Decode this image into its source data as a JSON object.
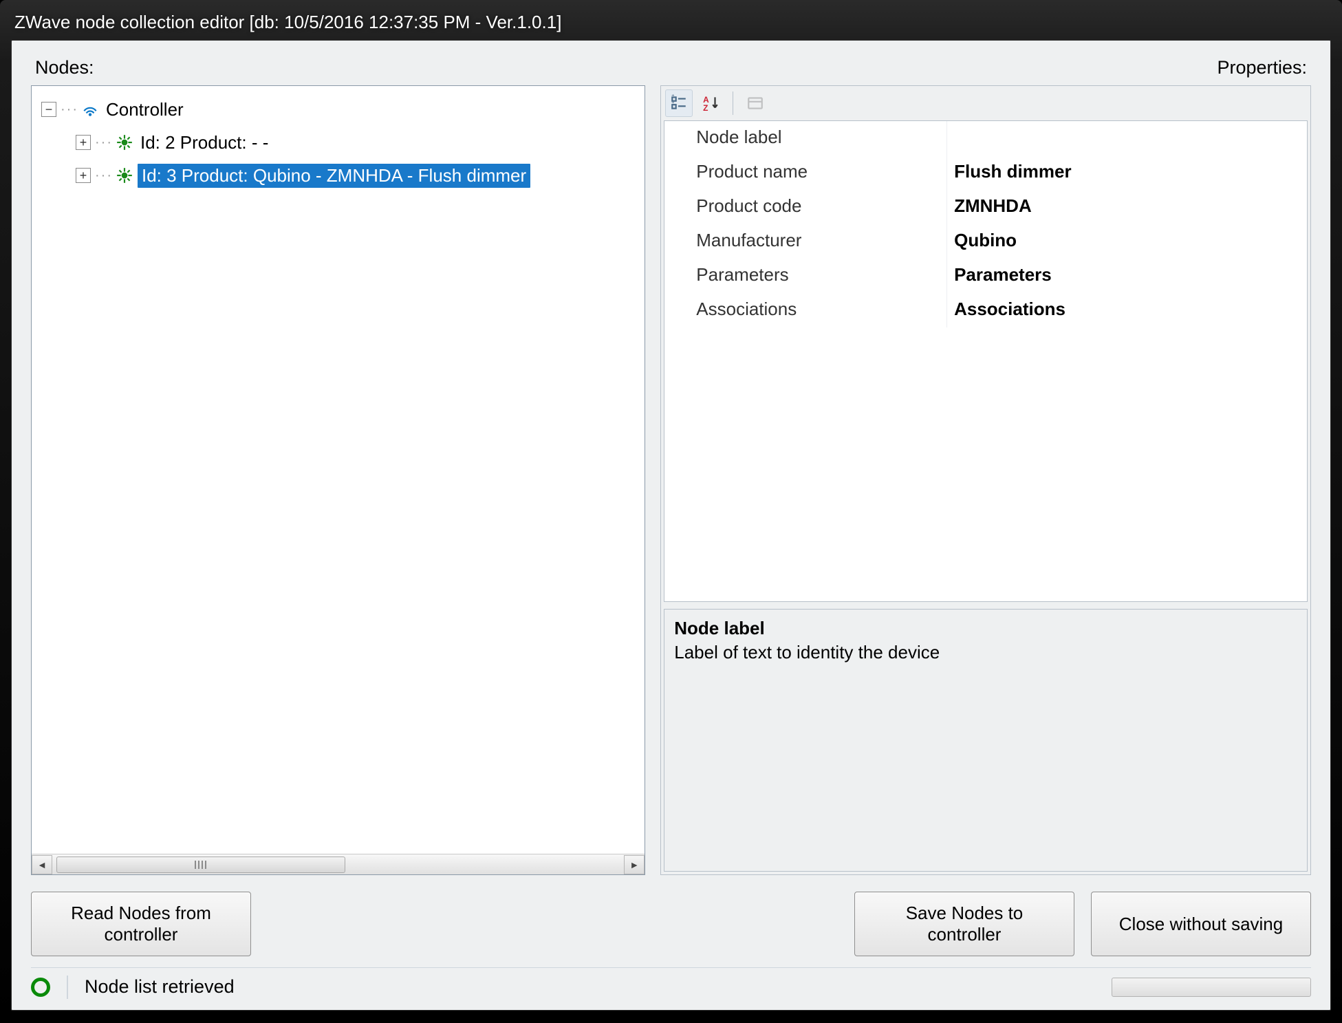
{
  "window": {
    "title": "ZWave node collection editor [db: 10/5/2016 12:37:35 PM - Ver.1.0.1]"
  },
  "labels": {
    "nodes": "Nodes:",
    "properties": "Properties:"
  },
  "tree": {
    "root": {
      "label": "Controller",
      "expanded": true
    },
    "items": [
      {
        "label": "Id: 2 Product:  -  -",
        "selected": false
      },
      {
        "label": "Id: 3 Product: Qubino - ZMNHDA - Flush dimmer",
        "selected": true
      }
    ]
  },
  "propgrid": {
    "rows": [
      {
        "name": "Node label",
        "value": ""
      },
      {
        "name": "Product name",
        "value": "Flush dimmer"
      },
      {
        "name": "Product code",
        "value": "ZMNHDA"
      },
      {
        "name": "Manufacturer",
        "value": "Qubino"
      },
      {
        "name": "Parameters",
        "value": "Parameters"
      },
      {
        "name": "Associations",
        "value": "Associations"
      }
    ],
    "help": {
      "title": "Node label",
      "desc": "Label of text to identity the device"
    }
  },
  "buttons": {
    "read": "Read Nodes from\ncontroller",
    "save": "Save Nodes to\ncontroller",
    "close": "Close without saving"
  },
  "status": {
    "text": "Node list retrieved"
  }
}
